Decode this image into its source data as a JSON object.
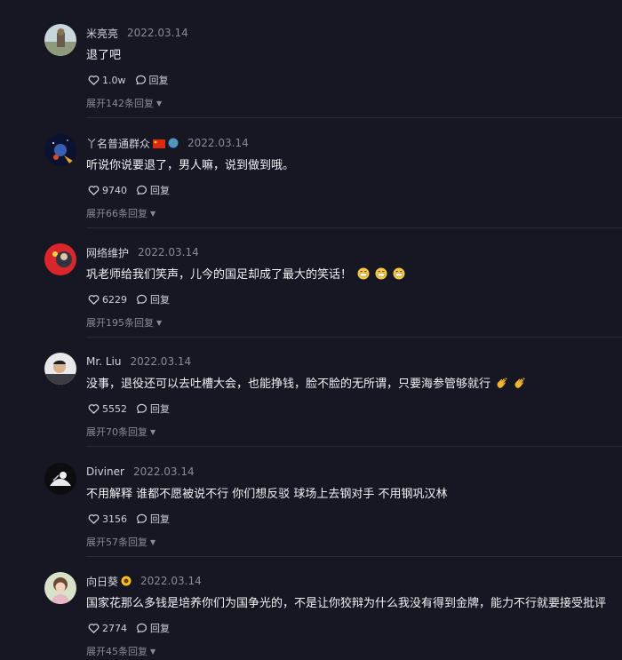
{
  "comments": [
    {
      "user": "米亮亮",
      "date": "2022.03.14",
      "text": "退了吧",
      "likes": "1.0w",
      "reply_label": "回复",
      "expand": "展开142条回复"
    },
    {
      "user": "丫名普通群众",
      "date": "2022.03.14",
      "text": "听说你说要退了，男人嘛，说到做到哦。",
      "likes": "9740",
      "reply_label": "回复",
      "expand": "展开66条回复"
    },
    {
      "user": "网络维护",
      "date": "2022.03.14",
      "text": "巩老师给我们笑声，儿今的国足却成了最大的笑话！",
      "likes": "6229",
      "reply_label": "回复",
      "expand": "展开195条回复"
    },
    {
      "user": "Mr. Liu",
      "date": "2022.03.14",
      "text": "没事，退役还可以去吐槽大会，也能挣钱，脸不脸的无所谓，只要海参管够就行",
      "likes": "5552",
      "reply_label": "回复",
      "expand": "展开70条回复"
    },
    {
      "user": "Diviner",
      "date": "2022.03.14",
      "text": "不用解释 谁都不愿被说不行 你们想反驳 球场上去钢对手 不用钢巩汉林",
      "likes": "3156",
      "reply_label": "回复",
      "expand": "展开57条回复"
    },
    {
      "user": "向日葵",
      "date": "2022.03.14",
      "text": "国家花那么多钱是培养你们为国争光的，不是让你狡辩为什么我没有得到金牌，能力不行就要接受批评",
      "likes": "2774",
      "reply_label": "回复",
      "expand": "展开45条回复"
    }
  ]
}
